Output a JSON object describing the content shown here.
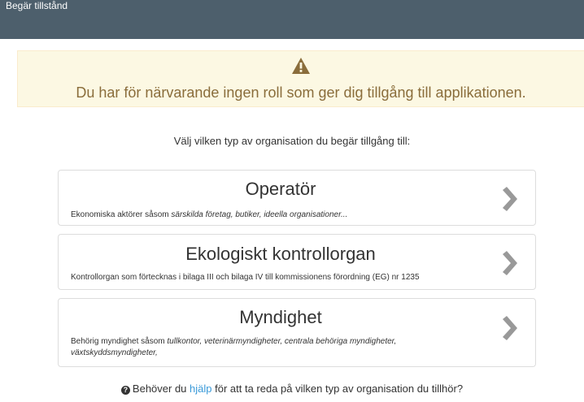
{
  "titlebar": {
    "title": "Begär tillstånd"
  },
  "warning": {
    "icon": "warning-triangle-icon",
    "message": "Du har för närvarande ingen roll som ger dig tillgång till applikationen."
  },
  "prompt": "Välj vilken typ av organisation du begär tillgång till:",
  "cards": [
    {
      "title": "Operatör",
      "desc_plain": "Ekonomiska aktörer såsom ",
      "desc_italic": "särskilda företag, butiker, ideella organisationer...",
      "icon": "chevron-right-icon"
    },
    {
      "title": "Ekologiskt kontrollorgan",
      "desc_plain": "Kontrollorgan som förtecknas i bilaga III och bilaga IV till kommissionens förordning (EG) nr 1235",
      "desc_italic": "",
      "icon": "chevron-right-icon"
    },
    {
      "title": "Myndighet",
      "desc_plain": "Behörig myndighet såsom ",
      "desc_italic": "tullkontor, veterinärmyndigheter, centrala behöriga myndigheter, växtskyddsmyndigheter,",
      "icon": "chevron-right-icon"
    }
  ],
  "help": {
    "icon": "question-circle-icon",
    "before": "Behöver du ",
    "link": "hjälp",
    "after": " för att ta reda på vilken typ av organisation du tillhör?"
  },
  "colors": {
    "titlebar_bg": "#4d5f6c",
    "warning_bg": "#fcf8e3",
    "warning_text": "#8a6d3b",
    "link": "#3a9ad9",
    "chevron": "#999999"
  }
}
